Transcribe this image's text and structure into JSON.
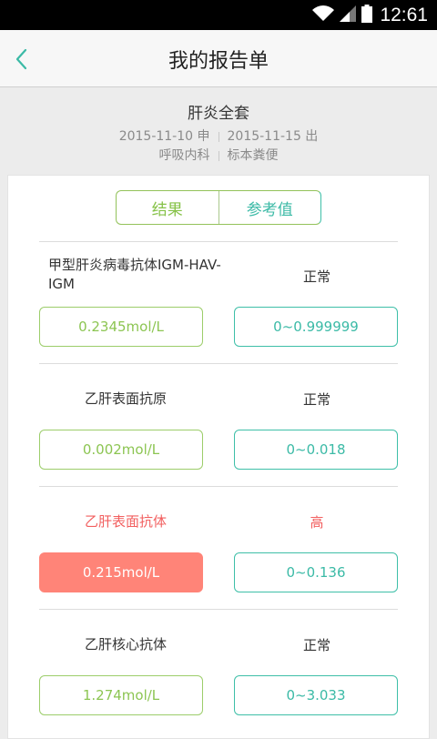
{
  "status_bar": {
    "time": "12:61"
  },
  "header": {
    "title": "我的报告单"
  },
  "report": {
    "name": "肝炎全套",
    "apply_date": "2015-11-10 申",
    "result_date": "2015-11-15 出",
    "department": "呼吸内科",
    "specimen": "标本粪便"
  },
  "tabs": {
    "result": "结果",
    "reference": "参考值"
  },
  "items": [
    {
      "name": "甲型肝炎病毒抗体IGM-HAV-IGM",
      "status": "正常",
      "value": "0.2345mol/L",
      "reference": "0~0.999999"
    },
    {
      "name": "乙肝表面抗原",
      "status": "正常",
      "value": "0.002mol/L",
      "reference": "0~0.018"
    },
    {
      "name": "乙肝表面抗体",
      "status": "高",
      "value": "0.215mol/L",
      "reference": "0~0.136"
    },
    {
      "name": "乙肝核心抗体",
      "status": "正常",
      "value": "1.274mol/L",
      "reference": "0~3.033"
    }
  ],
  "colors": {
    "green": "#86c248",
    "teal": "#3bbaa6",
    "alert_red": "#f25f5f",
    "alert_fill": "#ff8478"
  }
}
